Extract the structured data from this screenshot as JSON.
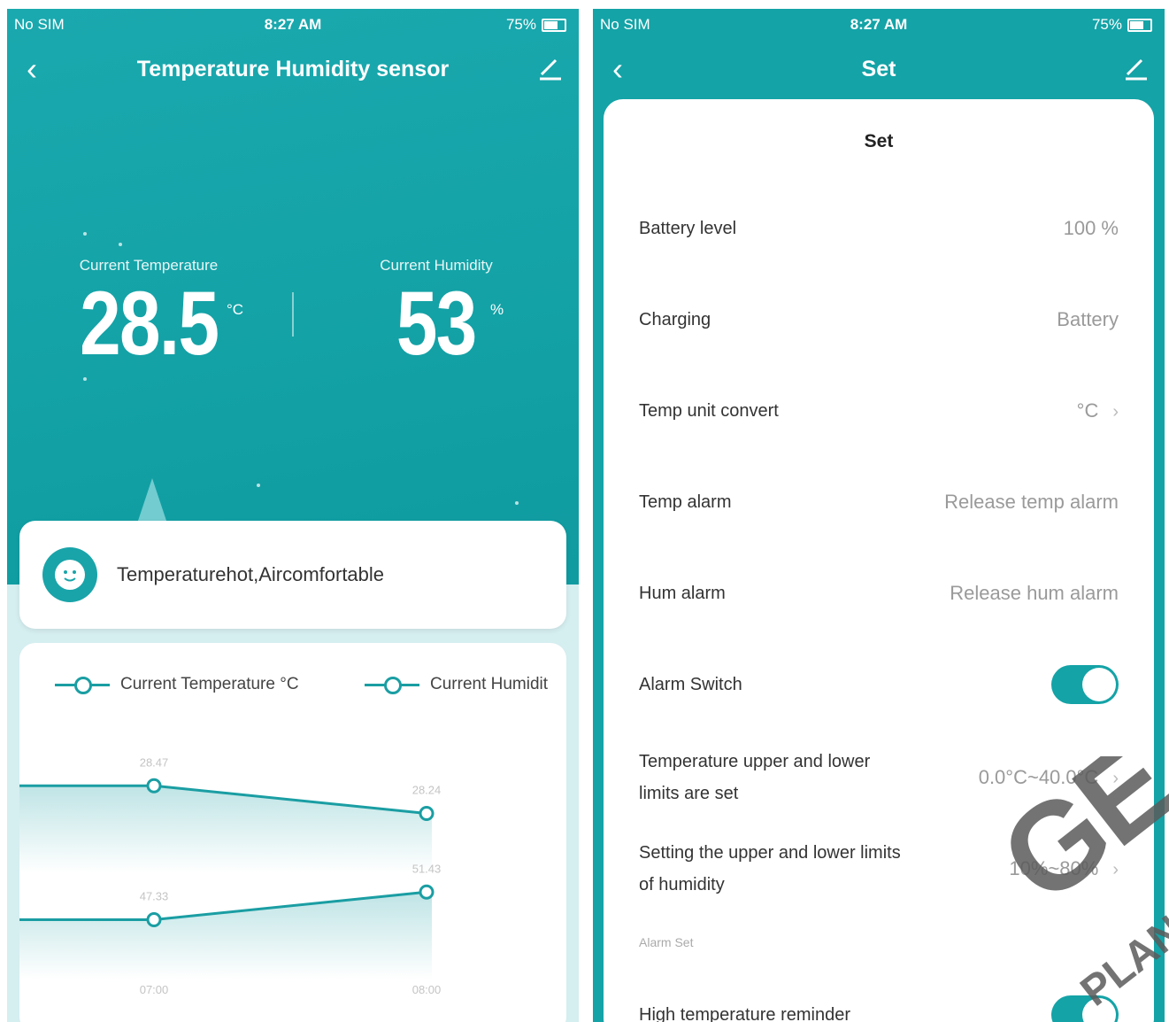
{
  "status_bar": {
    "carrier": "No SIM",
    "time": "8:27 AM",
    "battery": "75%"
  },
  "sensor_screen": {
    "title": "Temperature Humidity sensor",
    "temperature": {
      "label": "Current Temperature",
      "value": "28.5",
      "unit": "°C"
    },
    "humidity": {
      "label": "Current Humidity",
      "value": "53",
      "unit": "%"
    },
    "comfort_text": "Temperaturehot,Aircomfortable",
    "legend": {
      "temperature": "Current Temperature °C",
      "humidity": "Current Humidit"
    },
    "chart_data": {
      "type": "area",
      "x": [
        "07:00",
        "08:00"
      ],
      "series": [
        {
          "name": "Current Temperature °C",
          "values": [
            28.47,
            28.24
          ],
          "labels": [
            "28.47",
            "28.24"
          ]
        },
        {
          "name": "Current Humidit",
          "values": [
            47.33,
            51.43
          ],
          "labels": [
            "47.33",
            "51.43"
          ]
        }
      ],
      "tick_labels": [
        "07:00",
        "08:00"
      ]
    }
  },
  "settings_screen": {
    "title": "Set",
    "panel_title": "Set",
    "rows": [
      {
        "label": "Battery level",
        "value": "100 %"
      },
      {
        "label": "Charging",
        "value": "Battery"
      },
      {
        "label": "Temp unit convert",
        "value": "°C"
      },
      {
        "label": "Temp alarm",
        "value": "Release temp alarm"
      },
      {
        "label": "Hum alarm",
        "value": "Release hum alarm"
      },
      {
        "label": "Alarm Switch",
        "value": "on"
      },
      {
        "label": "Temperature upper and lower limits are set",
        "value": "0.0°C~40.0°C"
      },
      {
        "label": "Setting the upper and lower limits of humidity",
        "value": "10%~80%"
      },
      {
        "label": "High temperature reminder",
        "value": "on"
      }
    ],
    "section_header": "Alarm Set"
  },
  "watermark": {
    "text": "GET",
    "subtext": "PLAN"
  },
  "colors": {
    "teal": "#14a3a7",
    "line": "#1a9ea3"
  }
}
